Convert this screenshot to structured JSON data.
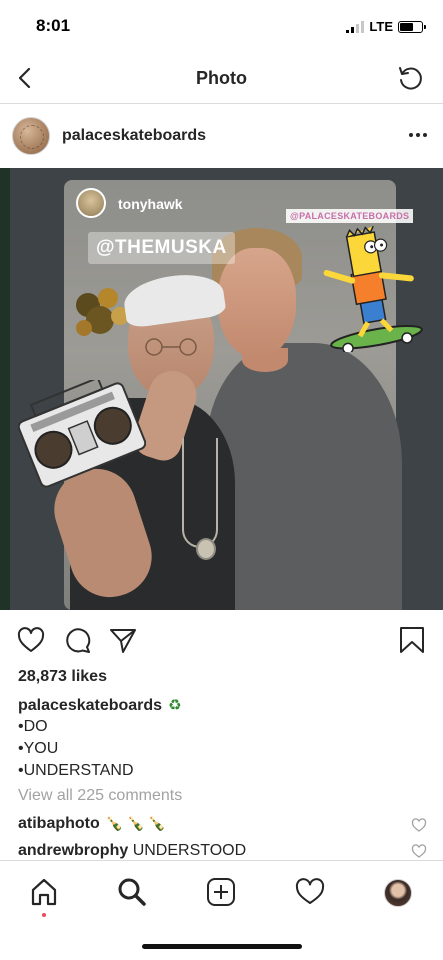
{
  "status": {
    "time": "8:01",
    "network": "LTE"
  },
  "nav": {
    "title": "Photo"
  },
  "post": {
    "username": "palaceskateboards",
    "photo": {
      "story_user": "tonyhawk",
      "sticker_mention": "@THEMUSKA",
      "sticker_tag": "@PALACESKATEBOARDS"
    },
    "likes": "28,873 likes",
    "caption": {
      "username": "palaceskateboards",
      "emoji": "♻",
      "lines": [
        "•DO",
        "•YOU",
        "•UNDERSTAND"
      ]
    },
    "view_comments": "View all 225 comments",
    "comments": [
      {
        "user": "atibaphoto",
        "text": "🍾 🍾 🍾"
      },
      {
        "user": "andrewbrophy",
        "text": "UNDERSTOOD"
      }
    ]
  },
  "colors": {
    "accent_dot": "#ed4956",
    "text": "#262626",
    "muted": "#a2a2a2",
    "divider": "#dbdbdb"
  },
  "icons": [
    "back-icon",
    "refresh-icon",
    "more-icon",
    "heart-icon",
    "comment-icon",
    "share-icon",
    "bookmark-icon",
    "home-icon",
    "search-icon",
    "add-icon",
    "activity-icon",
    "profile-icon"
  ]
}
